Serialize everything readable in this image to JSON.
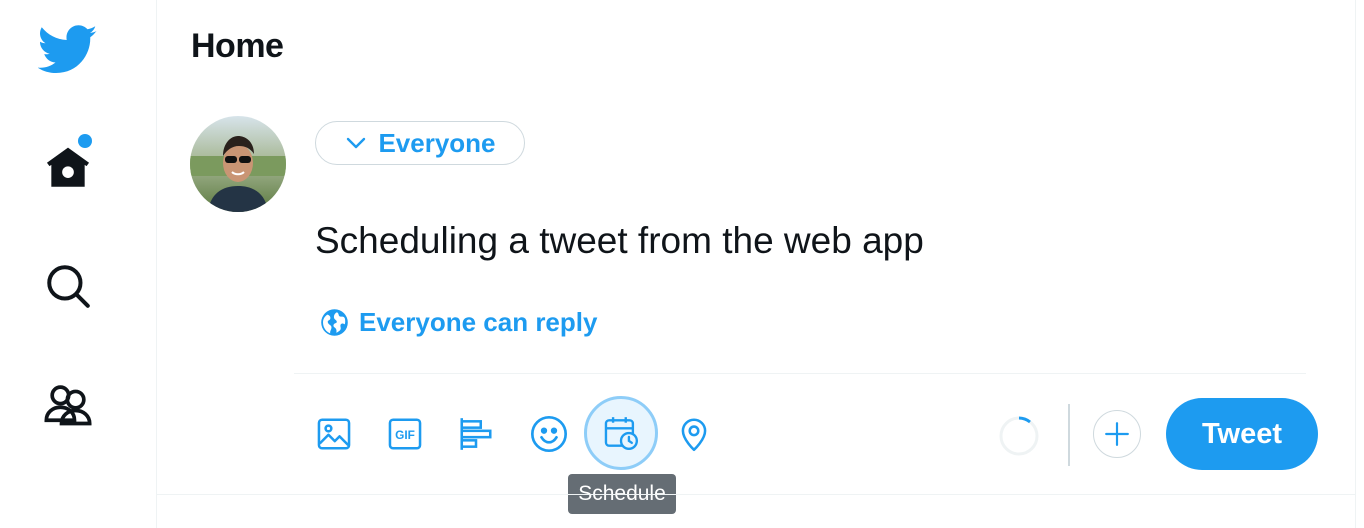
{
  "header": {
    "title": "Home"
  },
  "sidebar": {
    "items": [
      {
        "icon": "twitter-bird-icon"
      },
      {
        "icon": "home-icon",
        "has_notification_dot": true
      },
      {
        "icon": "search-icon"
      },
      {
        "icon": "communities-icon"
      }
    ]
  },
  "composer": {
    "audience_label": "Everyone",
    "text": "Scheduling a tweet from the web app",
    "reply_setting": "Everyone can reply",
    "toolbar": {
      "tools": [
        "media-icon",
        "gif-icon",
        "poll-icon",
        "emoji-icon",
        "schedule-icon",
        "location-icon"
      ],
      "active_tool": "schedule-icon",
      "gif_label": "GIF",
      "tooltip": "Schedule"
    },
    "tweet_button": "Tweet"
  },
  "colors": {
    "accent": "#1d9bf0",
    "text": "#0f1419",
    "border": "#cfd9de",
    "tooltip_bg": "#656d74"
  }
}
